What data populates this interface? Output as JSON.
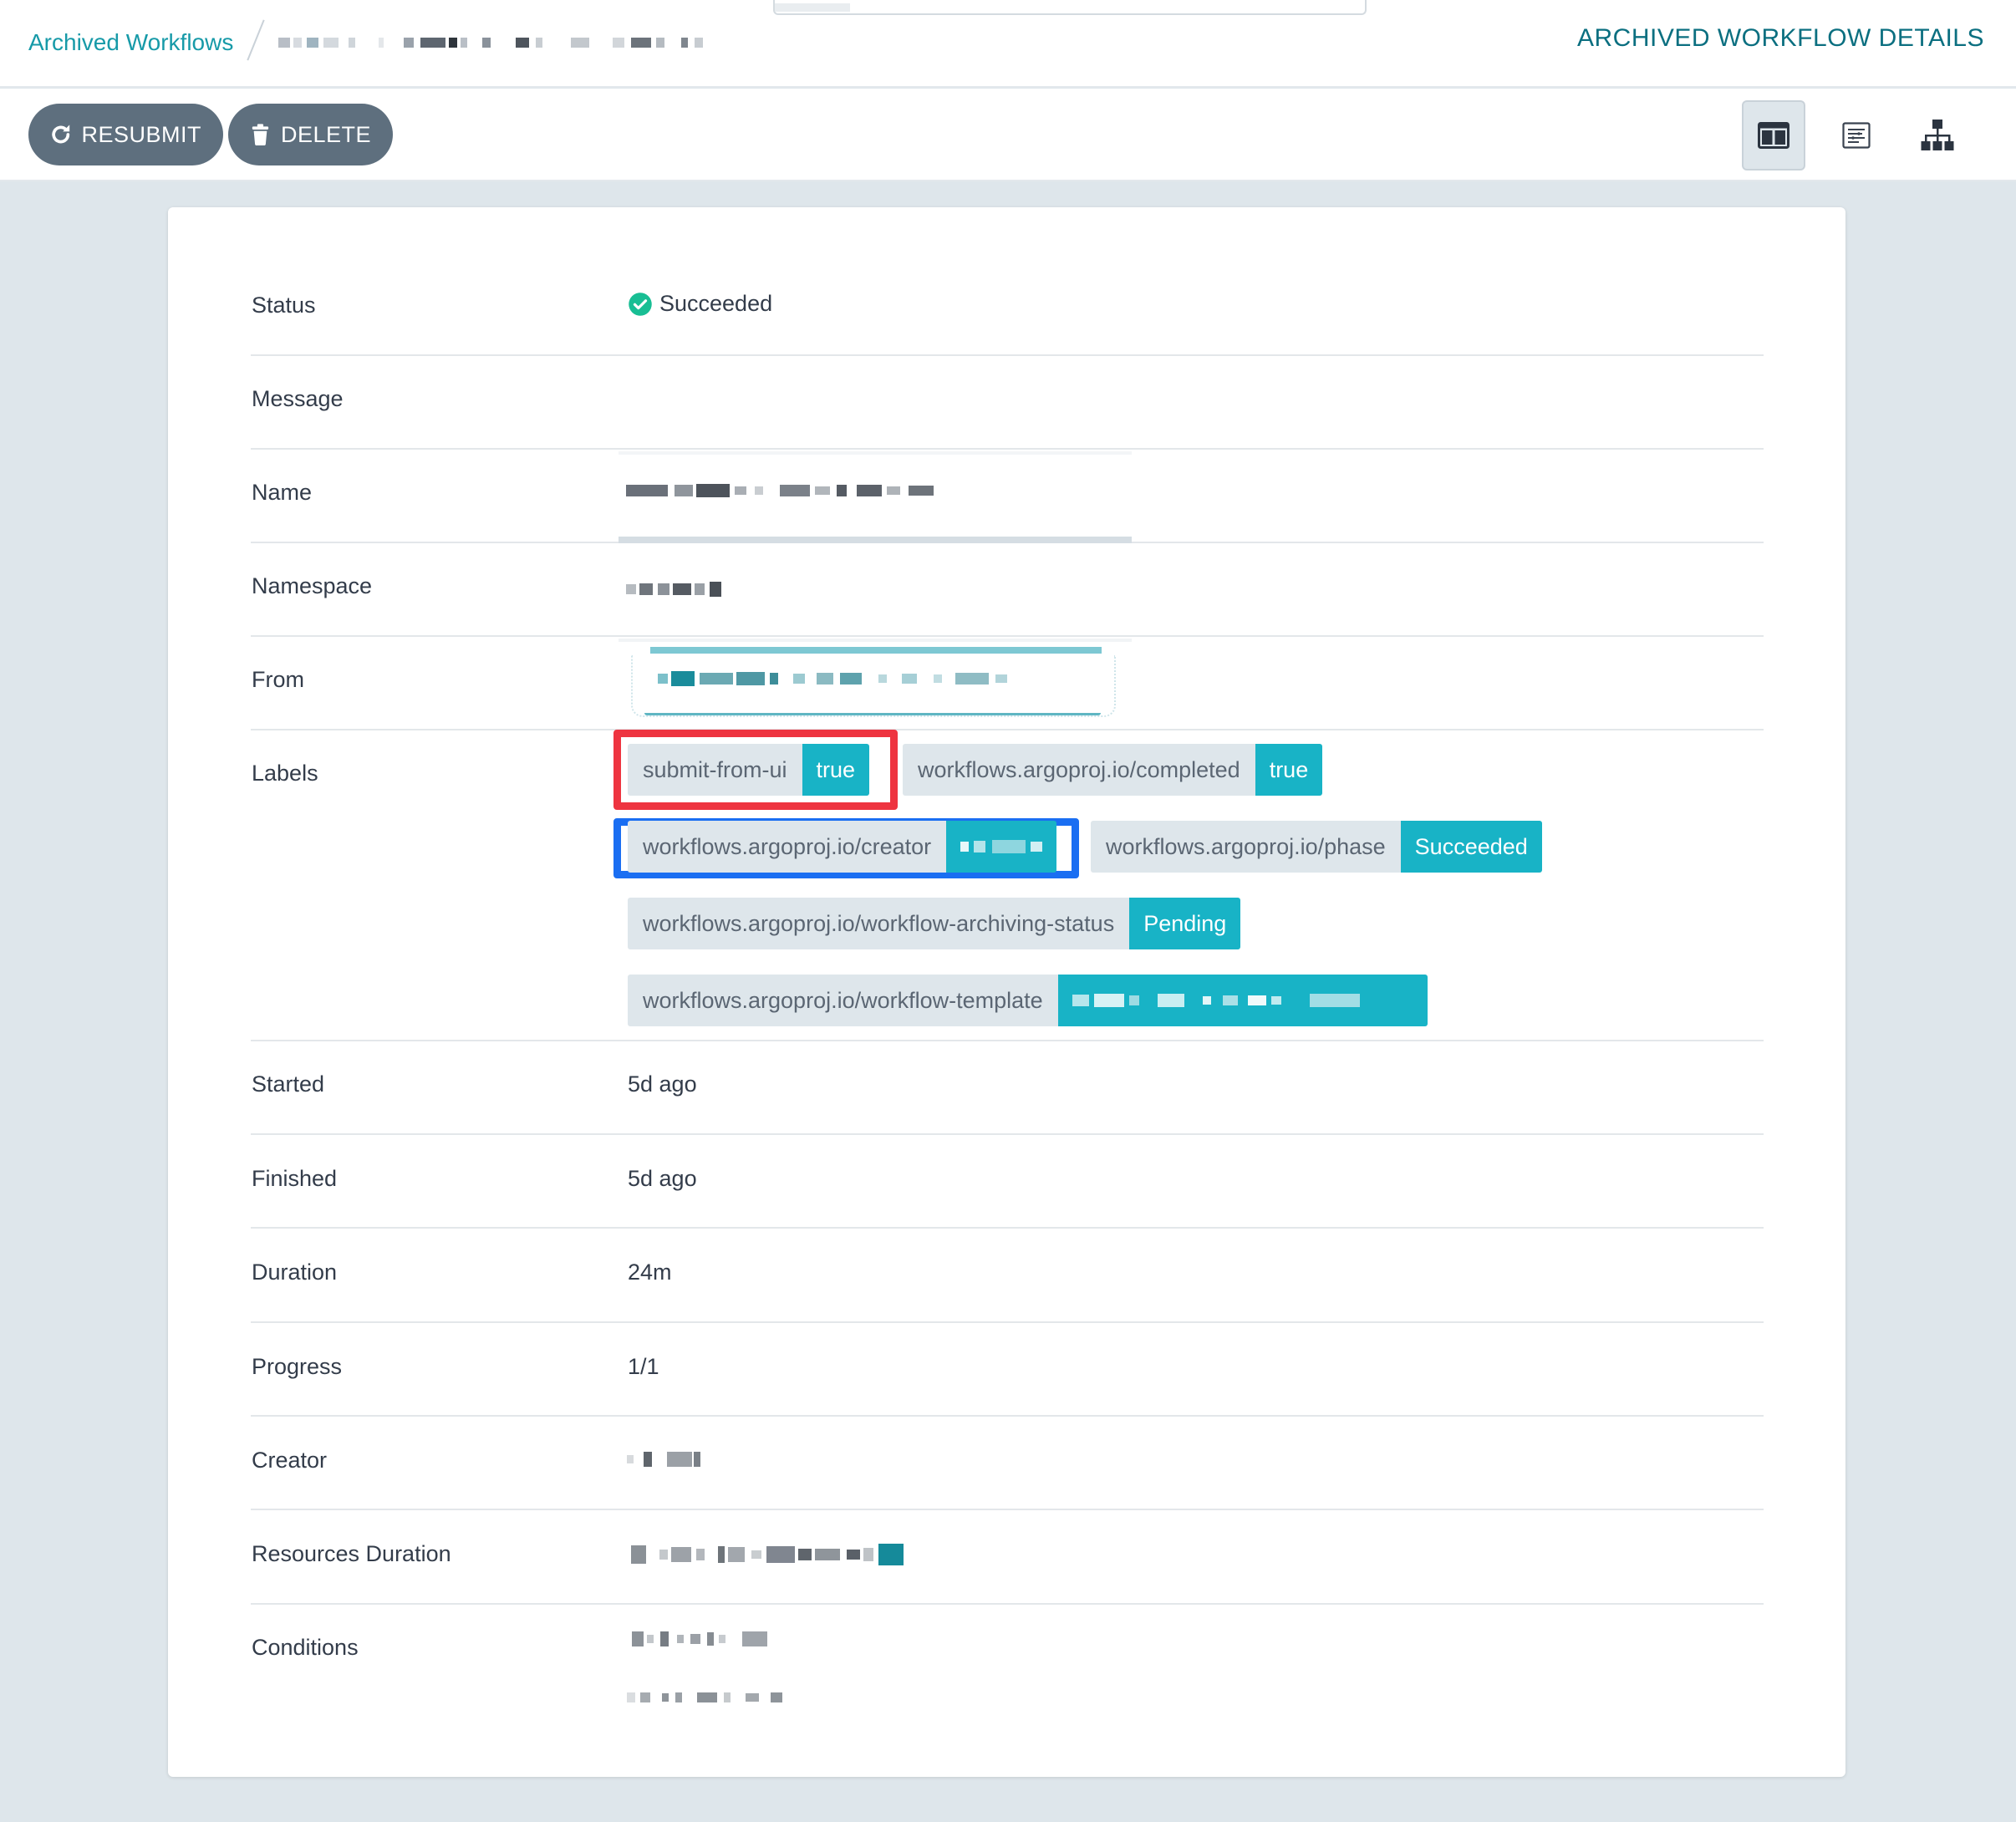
{
  "breadcrumb": {
    "link_label": "Archived Workflows"
  },
  "header": {
    "title": "ARCHIVED WORKFLOW DETAILS"
  },
  "toolbar": {
    "resubmit_label": "RESUBMIT",
    "delete_label": "DELETE",
    "views": [
      {
        "icon": "columns-icon",
        "active": true
      },
      {
        "icon": "yaml-list-icon",
        "active": false
      },
      {
        "icon": "graph-tree-icon",
        "active": false
      }
    ]
  },
  "colors": {
    "accent": "#18b3c6",
    "link": "#179aa8",
    "title": "#0b6f80",
    "button": "#5e6f7e",
    "success": "#18be94",
    "highlight_red": "#ee3440",
    "highlight_blue": "#1a6ef2"
  },
  "details": {
    "status_key": "Status",
    "status_value": "Succeeded",
    "message_key": "Message",
    "name_key": "Name",
    "namespace_key": "Namespace",
    "from_key": "From",
    "labels_key": "Labels",
    "started_key": "Started",
    "started_value": "5d ago",
    "finished_key": "Finished",
    "finished_value": "5d ago",
    "duration_key": "Duration",
    "duration_value": "24m",
    "progress_key": "Progress",
    "progress_value": "1/1",
    "creator_key": "Creator",
    "resources_duration_key": "Resources Duration",
    "conditions_key": "Conditions"
  },
  "labels": [
    {
      "key": "submit-from-ui",
      "value": "true"
    },
    {
      "key": "workflows.argoproj.io/completed",
      "value": "true"
    },
    {
      "key": "workflows.argoproj.io/creator",
      "value": ""
    },
    {
      "key": "workflows.argoproj.io/phase",
      "value": "Succeeded"
    },
    {
      "key": "workflows.argoproj.io/workflow-archiving-status",
      "value": "Pending"
    },
    {
      "key": "workflows.argoproj.io/workflow-template",
      "value": ""
    }
  ]
}
